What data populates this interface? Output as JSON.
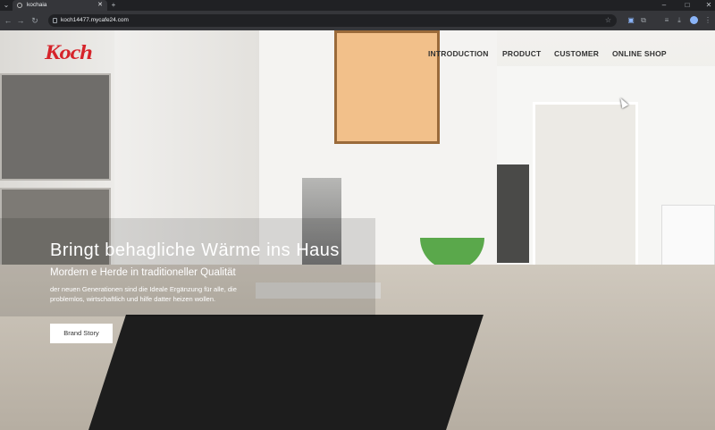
{
  "browser": {
    "tab_title": "kochaia",
    "url": "koch14477.mycafe24.com",
    "new_tab": "+",
    "tab_close": "✕"
  },
  "site": {
    "logo": "Koch",
    "nav": [
      "INTRODUCTION",
      "PRODUCT",
      "CUSTOMER",
      "ONLINE SHOP"
    ],
    "hero": {
      "heading": "Bringt behagliche Wärme ins Haus",
      "subheading": "Mordern e Herde in traditioneller Qualität",
      "paragraph": "der neuen Generationen sind die Ideale Ergänzung für alle, die problemlos, wirtschaftlich und hilfe datter heizen wollen.",
      "button": "Brand Story"
    }
  },
  "colors": {
    "brand": "#d6232a",
    "browser_frame": "#202124",
    "toolbar": "#35363a"
  }
}
